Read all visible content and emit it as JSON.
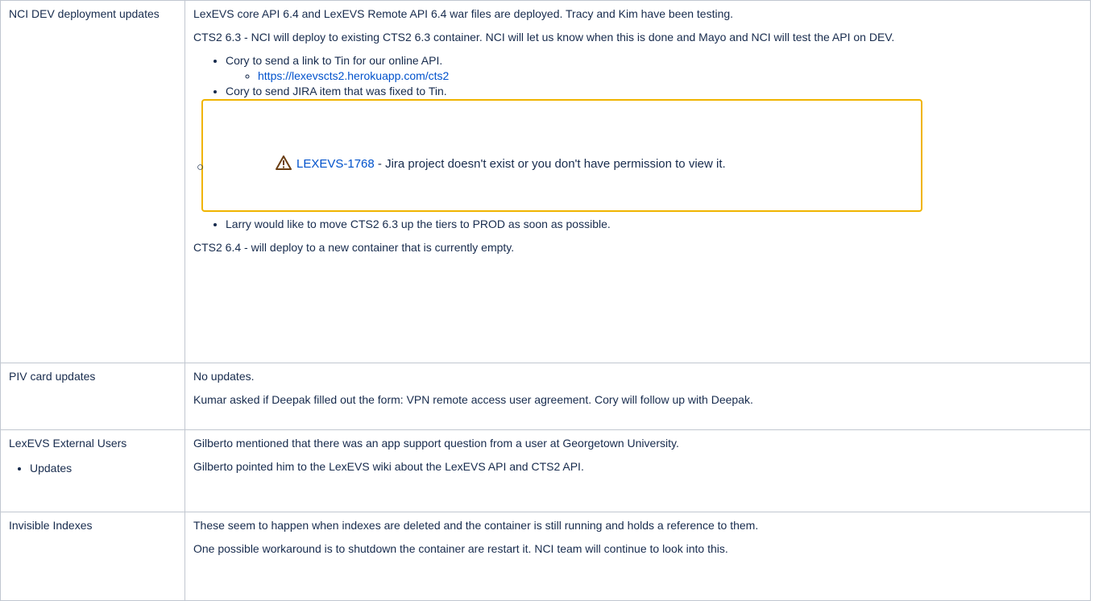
{
  "rows": [
    {
      "topic": "NCI DEV deployment updates",
      "p1": "LexEVS core API 6.4 and LexEVS Remote API 6.4 war files are deployed. Tracy and Kim have been testing.",
      "p2": "CTS2 6.3 - NCI will deploy to existing CTS2 6.3 container. NCI will let us know when this is done and Mayo and NCI will test the API on DEV.",
      "bullets": {
        "b1": "Cory to send a link to Tin for our online API.",
        "b1_link": "https://lexevscts2.herokuapp.com/cts2",
        "b2": "Cory to send JIRA item that was fixed to Tin.",
        "jira_key": "LEXEVS-1768",
        "jira_msg": " - Jira project doesn't exist or you don't have permission to view it.",
        "b3": "Larry would like to move CTS2 6.3 up the tiers to PROD as soon as possible."
      },
      "p3": "CTS2 6.4 - will deploy to a new container that is currently empty."
    },
    {
      "topic": "PIV card updates",
      "p1": "No updates.",
      "p2": "Kumar asked if Deepak filled out the form: VPN remote access user agreement. Cory will follow up with Deepak."
    },
    {
      "topic": "LexEVS External Users",
      "sub": "Updates",
      "p1": "Gilberto mentioned that there was an app support question from a user at Georgetown University.",
      "p2": "Gilberto pointed him to the LexEVS wiki about the LexEVS API and CTS2 API."
    },
    {
      "topic": "Invisible Indexes",
      "p1": "These seem to happen when indexes are deleted and the container is still running and holds a reference to them.",
      "p2": "One possible workaround is to shutdown the container are restart it. NCI team will continue to look into this."
    }
  ],
  "colors": {
    "text": "#172b4d",
    "link": "#0052cc",
    "border": "#c1c7d0",
    "jira_border": "#f0b400",
    "warning_icon": "#6b3f14"
  },
  "icons": {
    "warning": "warning-icon"
  }
}
